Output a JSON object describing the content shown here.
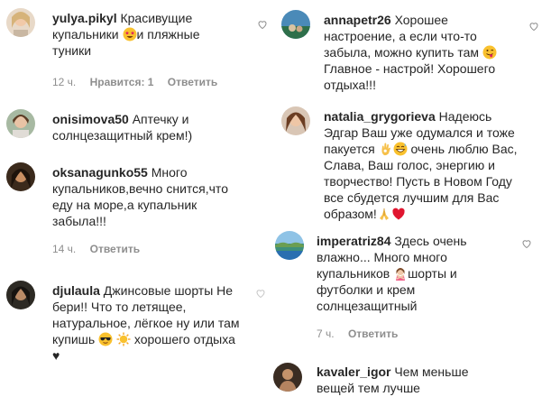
{
  "comments_left": [
    {
      "username": "yulya.pikyl",
      "text_before": "Красивущие купальники",
      "emoji_1": "star-struck-emoji",
      "text_after": "и пляжные туники",
      "time": "12 ч.",
      "likes": "Нравится: 1",
      "reply": "Ответить"
    },
    {
      "username": "onisimova50",
      "text": "Аптечку и солнцезащитный крем!)"
    },
    {
      "username": "oksanagunko55",
      "text": "Много купальников,вечно снится,что еду на море,а купальник забыла!!!",
      "time": "14 ч.",
      "reply": "Ответить"
    },
    {
      "username": "djulaula",
      "text_before": "Джинсовые шорты Не бери!! Что то летящее, натуральное, лёгкое ну или там купишь",
      "emoji_1": "sunglasses-emoji",
      "emoji_2": "sun-emoji",
      "text_after": "хорошего отдыха",
      "tail": "♥"
    }
  ],
  "comments_right": [
    {
      "username": "annapetr26",
      "text_before": "Хорошее настроение, а если что-то забыла, можно купить там",
      "emoji_1": "tongue-wink-emoji",
      "text_after": "Главное - настрой! Хорошего отдыха!!!"
    },
    {
      "username": "natalia_grygorieva",
      "text_before": "Надеюсь Эдгар Ваш уже одумался и тоже пакуется",
      "emoji_1": "ok-hand-emoji",
      "emoji_2": "grin-sweat-emoji",
      "text_after": "очень люблю Вас, Слава, Ваш голос, энергию и творчество! Пусть в Новом Году все сбудется лучшим для Вас образом!",
      "emoji_3": "pray-emoji",
      "emoji_4": "red-heart-emoji"
    },
    {
      "username": "imperatriz84",
      "text_before": "Здесь очень влажно... Много много купальников",
      "emoji_1": "person-gesturing-no-emoji",
      "text_after": "шорты и футболки и крем солнцезащитный",
      "time": "7 ч.",
      "reply": "Ответить"
    },
    {
      "username": "kavaler_igor",
      "text": "Чем меньше вещей тем лучше"
    }
  ]
}
